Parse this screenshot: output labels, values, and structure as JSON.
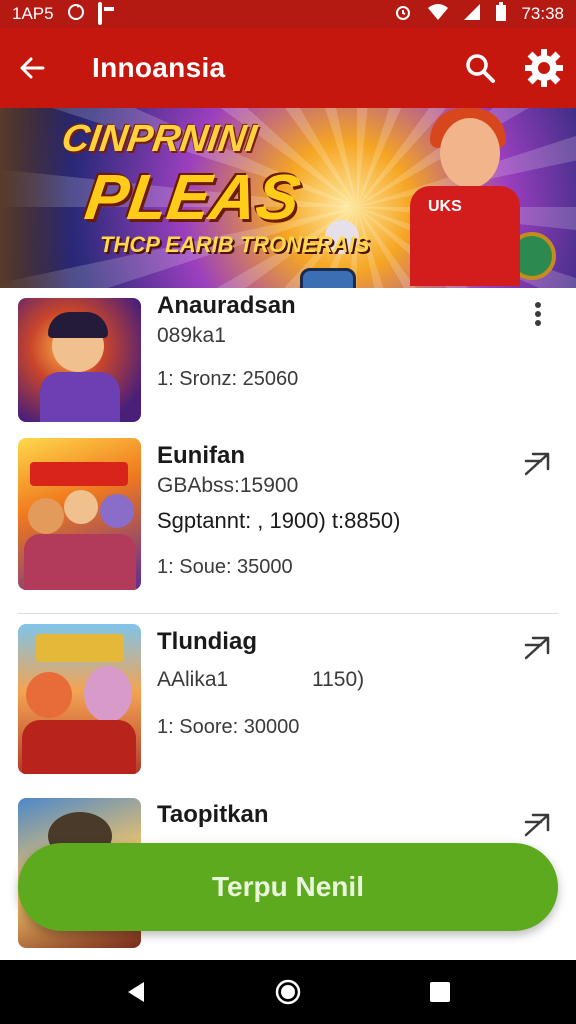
{
  "status_bar": {
    "left_text": "1AP5",
    "time": "73:38",
    "icons": [
      "sync-icon",
      "notification-box-icon",
      "alarm-icon",
      "wifi-icon",
      "signal-icon",
      "battery-icon"
    ]
  },
  "app_bar": {
    "title": "Innoansia",
    "icons": [
      "back-arrow-icon",
      "search-icon",
      "settings-gear-icon"
    ],
    "color": "#c6170f"
  },
  "banner": {
    "title_line1": "CINPRNINI",
    "title_line2": "PLEAS",
    "subtitle": "THCP EARIB TRONERAIS",
    "hero_shirt_text": "UKS"
  },
  "list": {
    "items": [
      {
        "title": "Anauradsan",
        "line1": "089ka1",
        "line2": "",
        "score": "1: Sronz: 25060",
        "action_icon": "more-vert-icon"
      },
      {
        "title": "Eunifan",
        "line1": "GBAbss:15900",
        "line2": "Sgptannt: , 1900) t:8850)",
        "score": "1: Soue: 35000",
        "action_icon": "share-arrow-icon"
      },
      {
        "title": "Tlundiag",
        "line1": "AAlika1",
        "line1_right": "1150)",
        "line2": "",
        "score": "1: Soore: 30000",
        "action_icon": "share-arrow-icon"
      },
      {
        "title": "Taopitkan",
        "line1": "",
        "line2": "",
        "score": "",
        "action_icon": "share-arrow-icon"
      }
    ]
  },
  "cta": {
    "label": "Terpu Nenil",
    "color": "#5eaa1e"
  },
  "nav_bar": {
    "buttons": [
      "back-triangle-icon",
      "home-circle-icon",
      "recents-square-icon"
    ]
  }
}
